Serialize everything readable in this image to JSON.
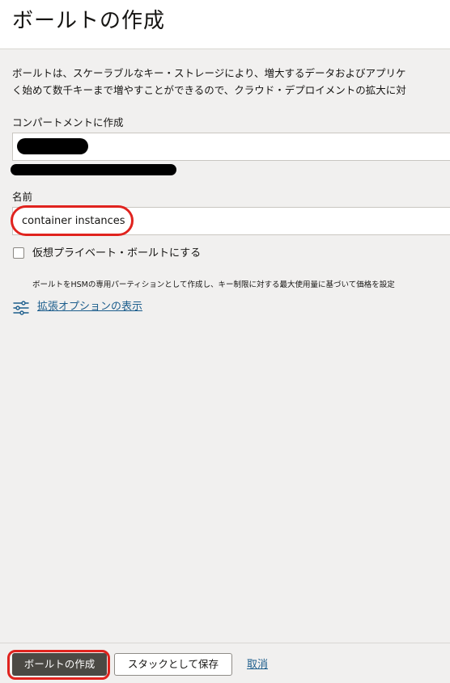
{
  "header": {
    "title": "ボールトの作成"
  },
  "description": {
    "line1": "ボールトは、スケーラブルなキー・ストレージにより、増大するデータおよびアプリケ",
    "line2": "く始めて数千キーまで増やすことができるので、クラウド・デプロイメントの拡大に対"
  },
  "compartment": {
    "label": "コンパートメントに作成"
  },
  "name_field": {
    "label": "名前",
    "value": "container instances"
  },
  "virtual_private_vault": {
    "label": "仮想プライベート・ボールトにする",
    "checked": false,
    "helper": "ボールトをHSMの専用パーティションとして作成し、キー制限に対する最大使用量に基づいて価格を設定"
  },
  "advanced": {
    "link_label": "拡張オプションの表示",
    "icon": "sliders-icon"
  },
  "footer": {
    "create_label": "ボールトの作成",
    "save_stack_label": "スタックとして保存",
    "cancel_label": "取消"
  },
  "colors": {
    "background": "#f1f0ef",
    "primary_button": "#4b4944",
    "link": "#1c5d8c",
    "highlight": "#e0231e"
  }
}
